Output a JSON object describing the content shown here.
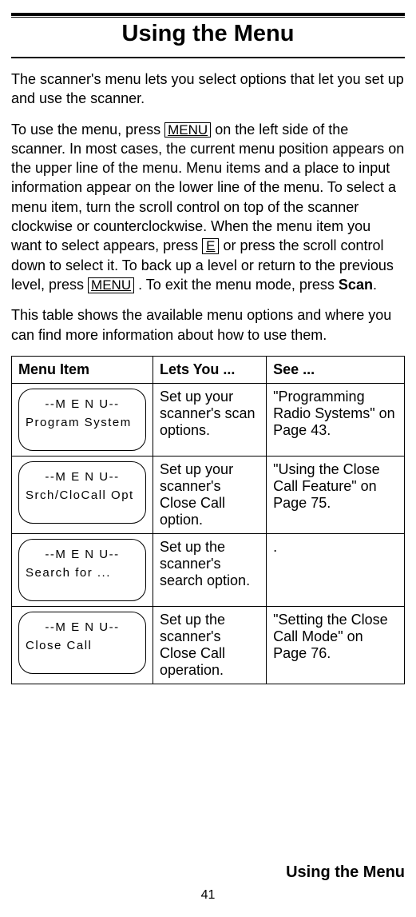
{
  "title": "Using the Menu",
  "para1": "The scanner's menu lets you select options that let you set up and use the scanner.",
  "para2_a": "To use the menu, press  ",
  "key_menu": "MENU",
  "para2_b": "  on the left side of the scanner. In most cases, the current menu position appears on the upper line of the menu. Menu items and a place to input information appear on the lower line of the menu. To select a menu item, turn the scroll control on top of the scanner clockwise or counterclockwise. When the menu item you want to select appears, press ",
  "key_e": "E",
  "para2_c": " or press the scroll control down to select it. To back up a level or return to the previous level, press  ",
  "para2_d": " . To exit the menu mode, press ",
  "scan_bold": "Scan",
  "para2_e": ".",
  "para3": "This table shows the available menu options and where you can find more information about how to use them.",
  "table": {
    "head": {
      "c1": "Menu Item",
      "c2": "Lets You ...",
      "c3": "See ..."
    },
    "rows": [
      {
        "lcd1": "--M E N U--",
        "lcd2": "Program System",
        "lets": "Set up your scanner's scan options.",
        "see": "\"Programming Radio Systems\" on Page 43."
      },
      {
        "lcd1": "--M E N U--",
        "lcd2": "Srch/CloCall Opt",
        "lets": "Set up your scanner's Close Call option.",
        "see": "\"Using the Close Call Feature\" on Page 75."
      },
      {
        "lcd1": "--M E N U--",
        "lcd2": "Search for ...",
        "lets": "Set up the scanner's search option.",
        "see": "."
      },
      {
        "lcd1": "--M E N U--",
        "lcd2": "Close Call",
        "lets": "Set up the scanner's Close Call operation.",
        "see": "\"Setting the Close Call Mode\" on Page 76."
      }
    ]
  },
  "footer_running": "Using the Menu",
  "footer_page": "41"
}
